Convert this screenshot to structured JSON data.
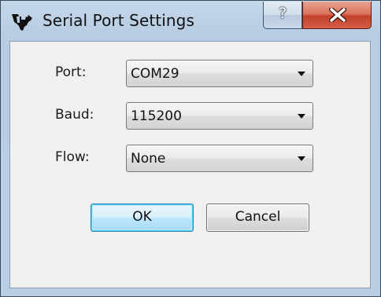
{
  "window": {
    "title": "Serial Port Settings",
    "help_label": "?",
    "app_icon": "ti-logo-icon"
  },
  "form": {
    "port": {
      "label": "Port:",
      "value": "COM29"
    },
    "baud": {
      "label": "Baud:",
      "value": "115200"
    },
    "flow": {
      "label": "Flow:",
      "value": "None"
    }
  },
  "buttons": {
    "ok": "OK",
    "cancel": "Cancel"
  },
  "colors": {
    "close_button": "#c3402a",
    "default_button_border": "#3c7fb1",
    "title_bar": "#b9cee4"
  }
}
